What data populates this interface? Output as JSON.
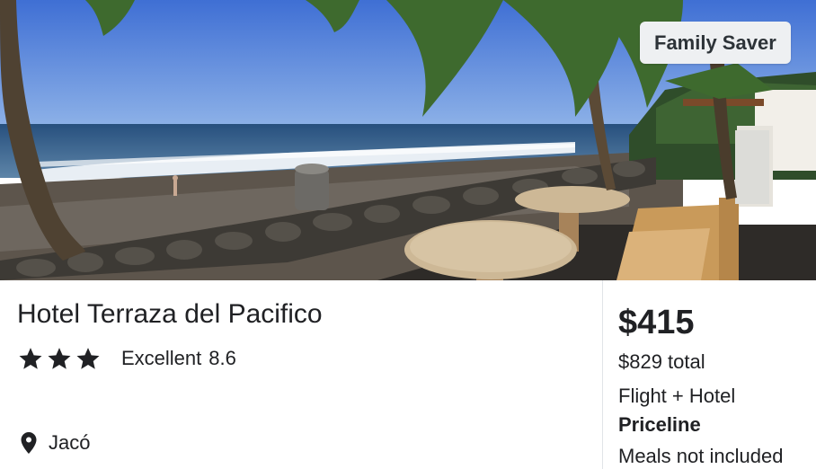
{
  "photo": {
    "badge_label": "Family Saver"
  },
  "hotel": {
    "name": "Hotel Terraza del Pacifico",
    "star_count": 3,
    "rating_label": "Excellent",
    "rating_score": "8.6",
    "location": "Jacó"
  },
  "price": {
    "nightly": "$415",
    "total": "$829 total",
    "package": "Flight + Hotel",
    "provider": "Priceline",
    "meals": "Meals not included"
  },
  "colors": {
    "text": "#202124",
    "badge_bg": "#eef0f2",
    "divider": "#e1e4e8"
  },
  "icons": [
    "star-icon",
    "location-pin-icon"
  ]
}
